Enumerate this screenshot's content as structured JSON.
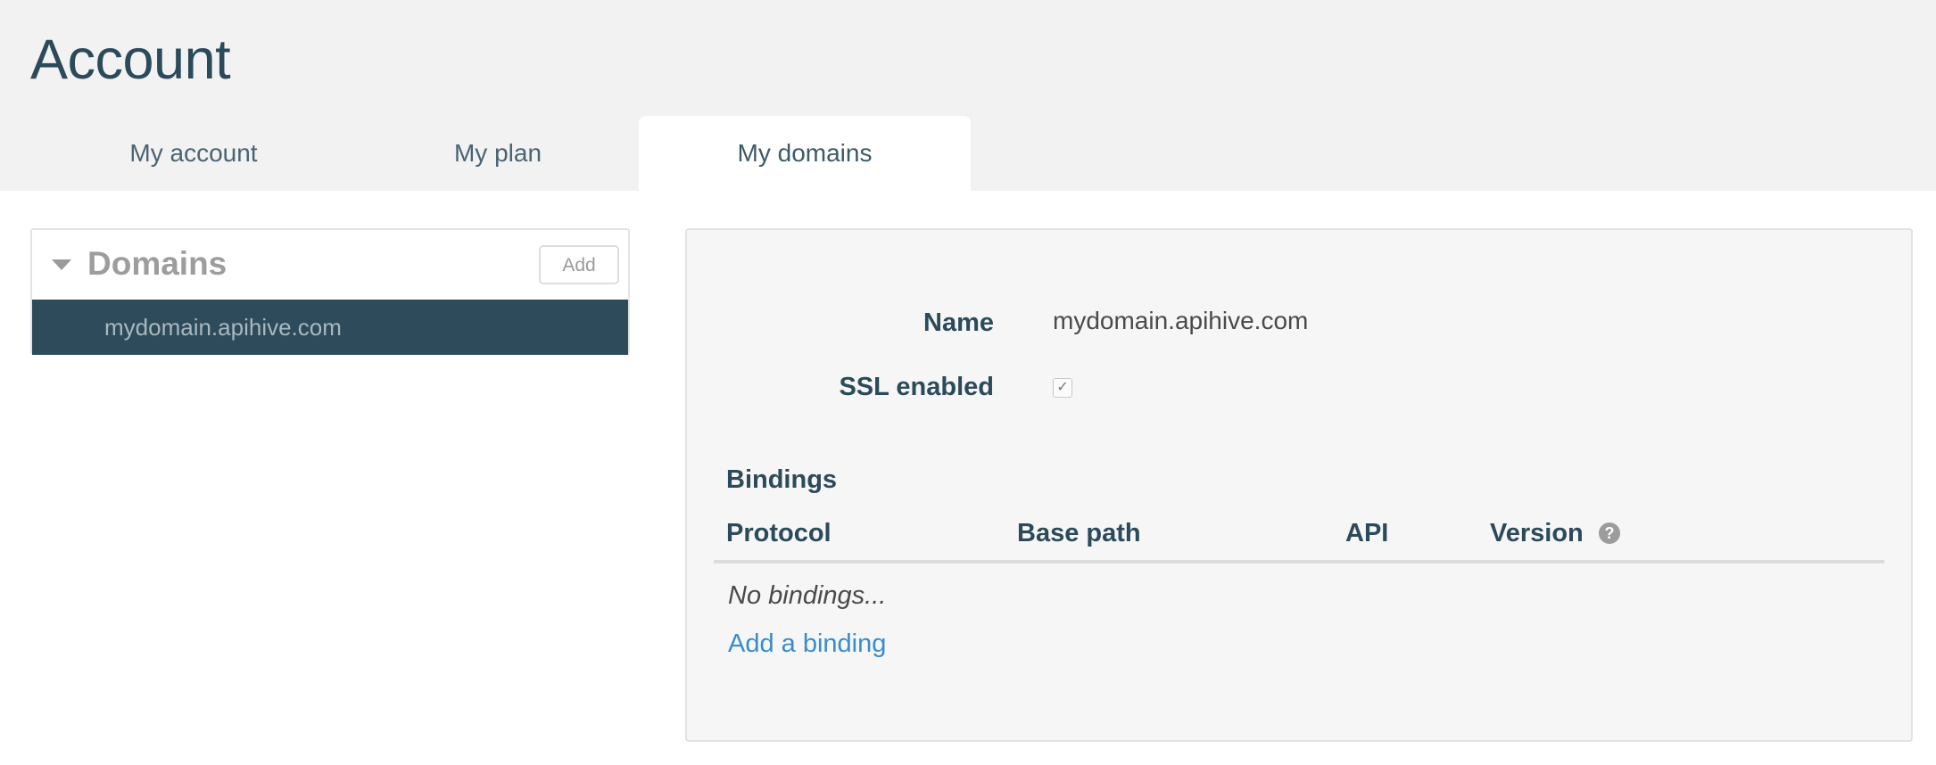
{
  "page": {
    "title": "Account"
  },
  "tabs": [
    {
      "label": "My account",
      "active": false
    },
    {
      "label": "My plan",
      "active": false
    },
    {
      "label": "My domains",
      "active": true
    }
  ],
  "domains_panel": {
    "title": "Domains",
    "add_label": "Add",
    "items": [
      {
        "label": "mydomain.apihive.com",
        "selected": true
      }
    ]
  },
  "detail": {
    "name_label": "Name",
    "name_value": "mydomain.apihive.com",
    "ssl_label": "SSL enabled",
    "ssl_checked": true,
    "ssl_check_glyph": "✓",
    "bindings": {
      "title": "Bindings",
      "columns": [
        "Protocol",
        "Base path",
        "API",
        "Version"
      ],
      "help_glyph": "?",
      "empty_text": "No bindings...",
      "add_link": "Add a binding"
    }
  },
  "colors": {
    "header_bg": "#f2f2f2",
    "title_text": "#2b4a5a",
    "selected_item_bg": "#2d4b5b",
    "link": "#3a8ccc",
    "panel_bg": "#f6f6f6"
  },
  "icons": {
    "collapse": "caret-down-icon",
    "help": "question-circle-icon",
    "checkbox": "checkbox-checked-icon"
  }
}
